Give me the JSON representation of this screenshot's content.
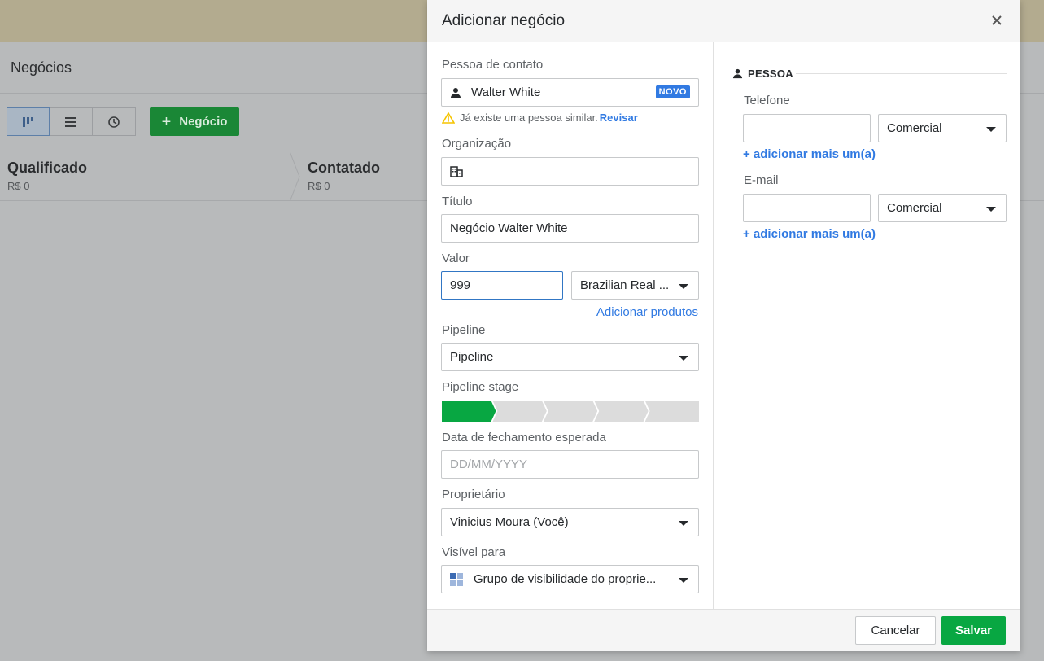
{
  "background": {
    "page_title": "Negócios",
    "new_deal_label": "Negócio",
    "stages": [
      {
        "name": "Qualificado",
        "amount": "R$ 0"
      },
      {
        "name": "Contatado",
        "amount": "R$ 0"
      }
    ]
  },
  "modal": {
    "title": "Adicionar negócio",
    "contact_person": {
      "label": "Pessoa de contato",
      "value": "Walter White",
      "badge": "NOVO",
      "warning_text": "Já existe uma pessoa similar.",
      "warning_link": "Revisar"
    },
    "organization": {
      "label": "Organização",
      "value": ""
    },
    "title_field": {
      "label": "Título",
      "value": "Negócio Walter White"
    },
    "value_field": {
      "label": "Valor",
      "value": "999",
      "currency": "Brazilian Real ..."
    },
    "add_products": "Adicionar produtos",
    "pipeline": {
      "label": "Pipeline",
      "value": "Pipeline"
    },
    "pipeline_stage": {
      "label": "Pipeline stage",
      "total": 5,
      "current": 1
    },
    "close_date": {
      "label": "Data de fechamento esperada",
      "placeholder": "DD/MM/YYYY"
    },
    "owner": {
      "label": "Proprietário",
      "value": "Vinicius Moura (Você)"
    },
    "visible_to": {
      "label": "Visível para",
      "value": "Grupo de visibilidade do proprie..."
    },
    "person_section": {
      "heading": "PESSOA",
      "phone_label": "Telefone",
      "phone_value": "",
      "phone_type": "Comercial",
      "email_label": "E-mail",
      "email_value": "",
      "email_type": "Comercial",
      "add_more": "+ adicionar mais um(a)"
    },
    "cancel_label": "Cancelar",
    "save_label": "Salvar"
  },
  "colors": {
    "accent_green": "#08a742",
    "link_blue": "#317ae2",
    "warning_yellow": "#f5c400"
  }
}
